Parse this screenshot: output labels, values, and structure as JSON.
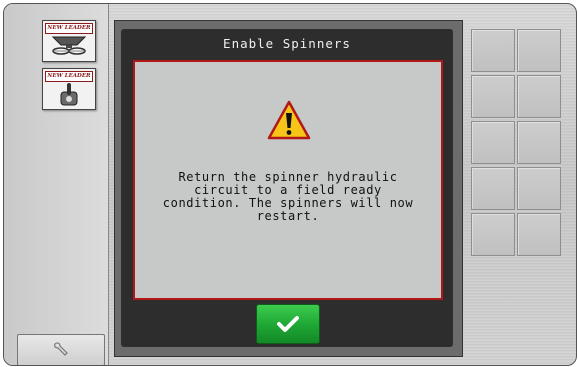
{
  "left_panel": {
    "apps": [
      {
        "brand": "NEW LEADER",
        "icon": "spreader-icon"
      },
      {
        "brand": "NEW LEADER",
        "icon": "toggle-switch-icon"
      }
    ],
    "tool_button_icon": "wrench-icon"
  },
  "dialog": {
    "title": "Enable Spinners",
    "warning_icon": "warning-triangle-icon",
    "message": "Return the spinner hydraulic\ncircuit to a field ready\ncondition. The spinners will now\nrestart.",
    "ok_icon": "checkmark-icon"
  },
  "right_panel": {
    "slot_rows": 5
  },
  "colors": {
    "accent_red": "#b01818",
    "ok_green": "#1ea534",
    "warning_yellow": "#f7c518"
  }
}
